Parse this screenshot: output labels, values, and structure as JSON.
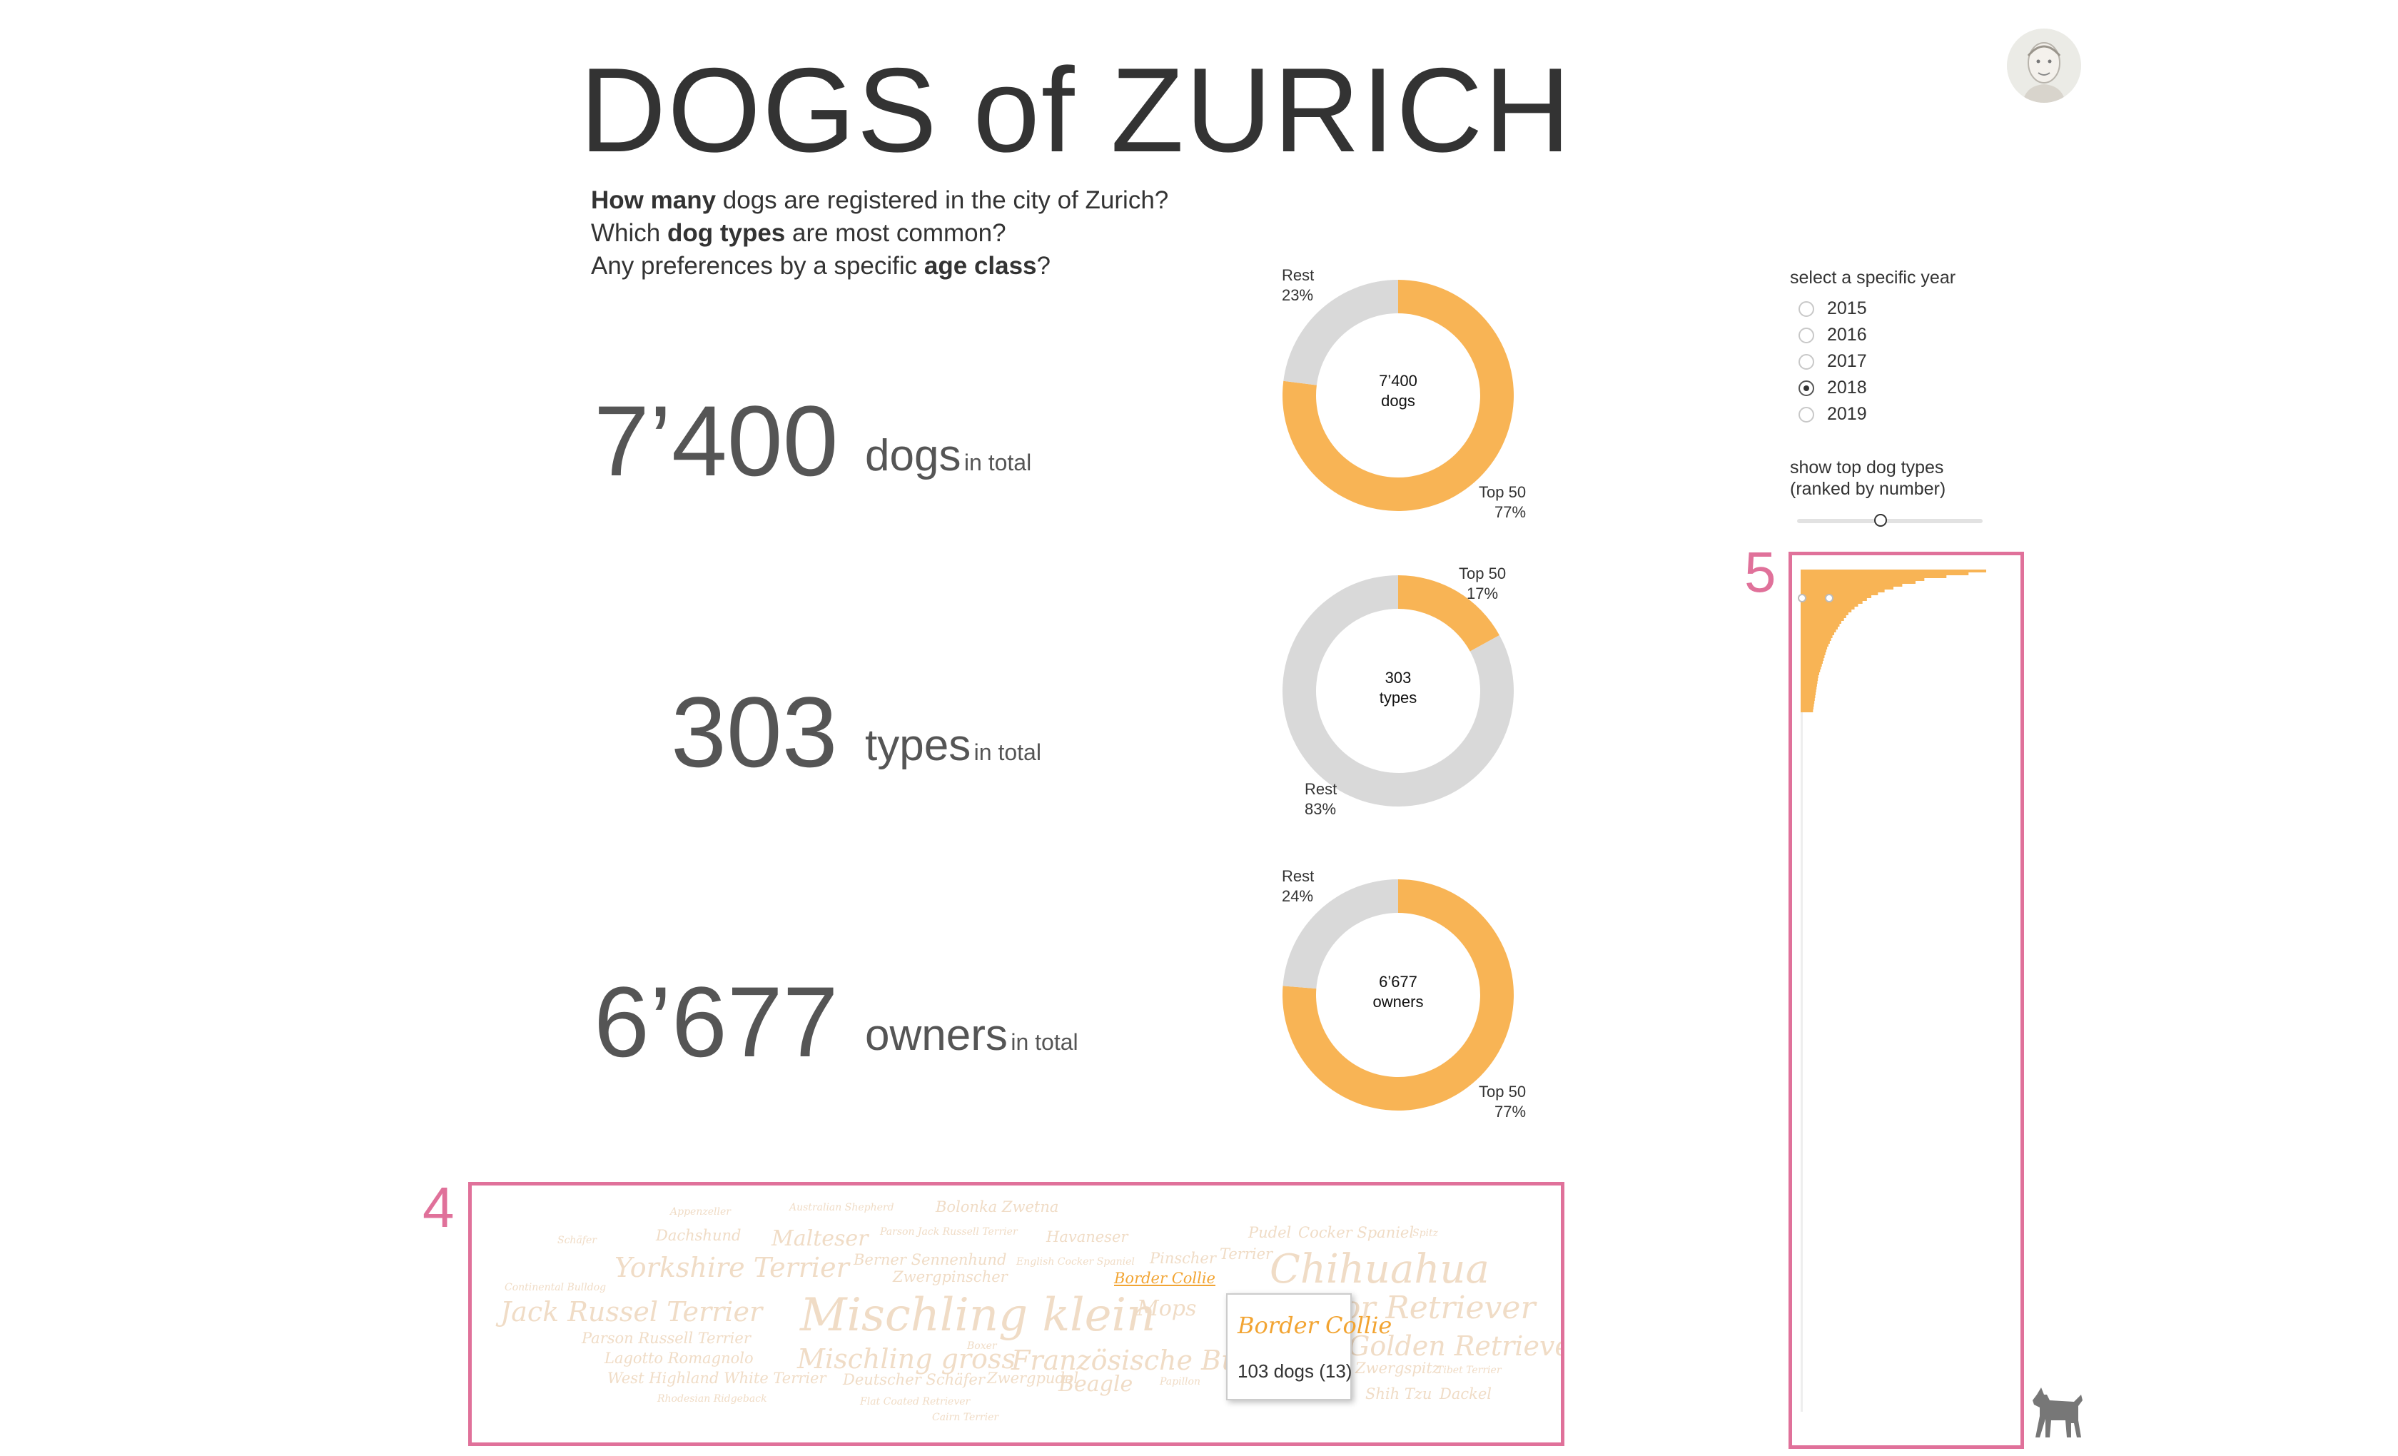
{
  "title": "DOGS of ZURICH",
  "questions": {
    "q1_bold": "How many",
    "q1_rest": " dogs are registered in the city of Zurich?",
    "q2_pre": "Which ",
    "q2_bold": "dog types",
    "q2_rest": " are most common?",
    "q3_pre": "Any preferences by a specific ",
    "q3_bold": "age class",
    "q3_rest": "?"
  },
  "stats": [
    {
      "number": "7’400",
      "word": "dogs",
      "suffix": "in total"
    },
    {
      "number": "303",
      "word": "types",
      "suffix": "in total"
    },
    {
      "number": "6’677",
      "word": "owners",
      "suffix": "in total"
    }
  ],
  "colors": {
    "accent": "#f8b455",
    "rest": "#d9d9d9",
    "highlight_box": "#e0719a",
    "wordcloud": "#f0dcc6"
  },
  "chart_data": [
    {
      "type": "pie",
      "center": [
        "7’400",
        "dogs"
      ],
      "slices": [
        {
          "label": "Top 50",
          "pct_label": "77%",
          "value": 77
        },
        {
          "label": "Rest",
          "pct_label": "23%",
          "value": 23
        }
      ]
    },
    {
      "type": "pie",
      "center": [
        "303",
        "types"
      ],
      "slices": [
        {
          "label": "Top 50",
          "pct_label": "17%",
          "value": 17
        },
        {
          "label": "Rest",
          "pct_label": "83%",
          "value": 83
        }
      ]
    },
    {
      "type": "pie",
      "center": [
        "6’677",
        "owners"
      ],
      "slices": [
        {
          "label": "Top 50",
          "pct_label": "77%",
          "value": 77
        },
        {
          "label": "Rest",
          "pct_label": "24%",
          "value": 24
        }
      ]
    }
  ],
  "year_select": {
    "label": "select a specific year",
    "options": [
      "2015",
      "2016",
      "2017",
      "2018",
      "2019"
    ],
    "selected": "2018"
  },
  "slider": {
    "label_line1": "show top dog types",
    "label_line2": "(ranked by number)",
    "value_fraction": 0.45
  },
  "panels": {
    "wordcloud_number": "4",
    "distribution_number": "5"
  },
  "distribution": {
    "counts": [
      420,
      380,
      330,
      280,
      260,
      230,
      210,
      190,
      175,
      160,
      150,
      140,
      130,
      122,
      115,
      108,
      103,
      98,
      92,
      88,
      84,
      80,
      76,
      72,
      69,
      66,
      63,
      60,
      58,
      56,
      54,
      52,
      50,
      48,
      46,
      44,
      42,
      40,
      39,
      38,
      37,
      36,
      35,
      34,
      33,
      32,
      31,
      30,
      29,
      28
    ],
    "rest_count": 253
  },
  "wordcloud": [
    {
      "text": "Appenzeller",
      "weight": 1
    },
    {
      "text": "Australian Shepherd",
      "weight": 1
    },
    {
      "text": "Bolonka Zwetna",
      "weight": 2
    },
    {
      "text": "Malteser",
      "weight": 3
    },
    {
      "text": "Schäfer",
      "weight": 1
    },
    {
      "text": "Dachshund",
      "weight": 2
    },
    {
      "text": "Parson Jack Russell Terrier",
      "weight": 1
    },
    {
      "text": "Havaneser",
      "weight": 2
    },
    {
      "text": "Pudel",
      "weight": 2
    },
    {
      "text": "Cocker Spaniel",
      "weight": 2
    },
    {
      "text": "Spitz",
      "weight": 1
    },
    {
      "text": "Yorkshire Terrier",
      "weight": 4
    },
    {
      "text": "Berner Sennenhund",
      "weight": 2
    },
    {
      "text": "English Cocker Spaniel",
      "weight": 1
    },
    {
      "text": "Pinscher",
      "weight": 2
    },
    {
      "text": "Terrier",
      "weight": 2
    },
    {
      "text": "Chihuahua",
      "weight": 6
    },
    {
      "text": "Zwergpinscher",
      "weight": 2
    },
    {
      "text": "Border Collie",
      "weight": 2,
      "highlight": true
    },
    {
      "text": "Continental Bulldog",
      "weight": 1
    },
    {
      "text": "Jack Russel Terrier",
      "weight": 4
    },
    {
      "text": "Mischling klein",
      "weight": 7
    },
    {
      "text": "Mops",
      "weight": 3
    },
    {
      "text": "Labrador Retriever",
      "weight": 5
    },
    {
      "text": "Parson Russell Terrier",
      "weight": 2
    },
    {
      "text": "Lagotto Romagnolo",
      "weight": 2
    },
    {
      "text": "Mischling gross",
      "weight": 4
    },
    {
      "text": "Boxer",
      "weight": 1
    },
    {
      "text": "Französische Bulldogge",
      "weight": 4
    },
    {
      "text": "Golden Retriever",
      "weight": 4
    },
    {
      "text": "West Highland White Terrier",
      "weight": 2
    },
    {
      "text": "Deutscher Schäfer",
      "weight": 2
    },
    {
      "text": "Zwergpudel",
      "weight": 2
    },
    {
      "text": "Beagle",
      "weight": 3
    },
    {
      "text": "Papillon",
      "weight": 1
    },
    {
      "text": "Zwergspitz",
      "weight": 2
    },
    {
      "text": "Tibet Terrier",
      "weight": 1
    },
    {
      "text": "Shih Tzu",
      "weight": 2
    },
    {
      "text": "Dackel",
      "weight": 2
    },
    {
      "text": "Rhodesian Ridgeback",
      "weight": 1
    },
    {
      "text": "Flat Coated Retriever",
      "weight": 1
    },
    {
      "text": "Cairn Terrier",
      "weight": 1
    }
  ],
  "tooltip": {
    "title": "Border Collie",
    "body": "103 dogs (13)"
  },
  "icons": {
    "avatar": "avatar",
    "dog": "dog-icon"
  }
}
